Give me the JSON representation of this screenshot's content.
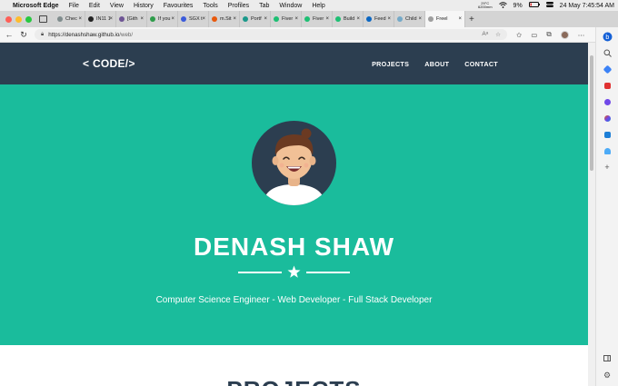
{
  "menubar": {
    "app": "Microsoft Edge",
    "items": [
      "File",
      "Edit",
      "View",
      "History",
      "Favourites",
      "Tools",
      "Profiles",
      "Tab",
      "Window",
      "Help"
    ],
    "weather_temp": "29°C",
    "weather_place": "6200mm",
    "battery": "9%",
    "datetime": "24 May  7:45:54 AM"
  },
  "tabs": [
    {
      "label": "Chec",
      "color": "#7f8c8d"
    },
    {
      "label": "IN11 1",
      "color": "#222222"
    },
    {
      "label": "[Gith",
      "color": "#6e5494"
    },
    {
      "label": "If you",
      "color": "#2e9c4a"
    },
    {
      "label": "SGX t",
      "color": "#3b5bdb"
    },
    {
      "label": "m.Sit",
      "color": "#e8590c"
    },
    {
      "label": "Portf",
      "color": "#1b998b"
    },
    {
      "label": "Fiver",
      "color": "#1dbf73"
    },
    {
      "label": "Fiver",
      "color": "#1dbf73"
    },
    {
      "label": "Build",
      "color": "#1dbf73"
    },
    {
      "label": "Feed",
      "color": "#0a66c2"
    },
    {
      "label": "Child",
      "color": "#74a9c8"
    },
    {
      "label": "Freel",
      "color": "#9e9e9e",
      "active": true
    }
  ],
  "address": {
    "url_host": "https://denashshaw.github.io",
    "url_path": "/web/"
  },
  "site": {
    "brand": "< CODE/>",
    "nav": [
      "PROJECTS",
      "ABOUT",
      "CONTACT"
    ],
    "name": "DENASH SHAW",
    "tagline": "Computer Science Engineer - Web Developer - Full Stack Developer",
    "section_title": "PROJECTS"
  },
  "colors": {
    "nav_bg": "#2c3e50",
    "hero_bg": "#1abc9c",
    "text_light": "#ffffff"
  }
}
